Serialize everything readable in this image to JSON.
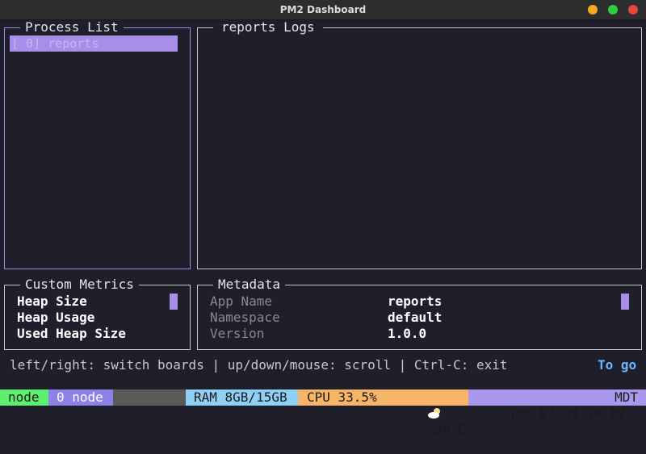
{
  "window": {
    "title": "PM2 Dashboard"
  },
  "process_list": {
    "title": "Process List",
    "items": [
      {
        "label": "[ 0] reports"
      }
    ]
  },
  "logs": {
    "title": "reports Logs"
  },
  "custom_metrics": {
    "title": "Custom Metrics",
    "items": [
      "Heap Size",
      "Heap Usage",
      "Used Heap Size"
    ]
  },
  "metadata": {
    "title": "Metadata",
    "rows": [
      {
        "key": "App Name",
        "value": "reports"
      },
      {
        "key": "Namespace",
        "value": "default"
      },
      {
        "key": "Version",
        "value": "1.0.0"
      }
    ]
  },
  "help_text": "left/right: switch boards | up/down/mouse: scroll | Ctrl-C: exit",
  "goto_text": "To go",
  "status_bar": {
    "session": "node",
    "window": "0 node",
    "ram": "RAM 8GB/15GB",
    "cpu": "CPU 33.5%",
    "weather_icon": "cloud-sun-icon",
    "weather": "+30°C",
    "datetime": "jue 07/09 10:09",
    "tz": "MDT",
    "colors": {
      "session_bg": "#5fef6f",
      "window_bg": "#8b82e8",
      "ram_bg": "#8fd0f5",
      "cpu_bg": "#f6b567",
      "datetime_bg": "#a998ee"
    }
  }
}
